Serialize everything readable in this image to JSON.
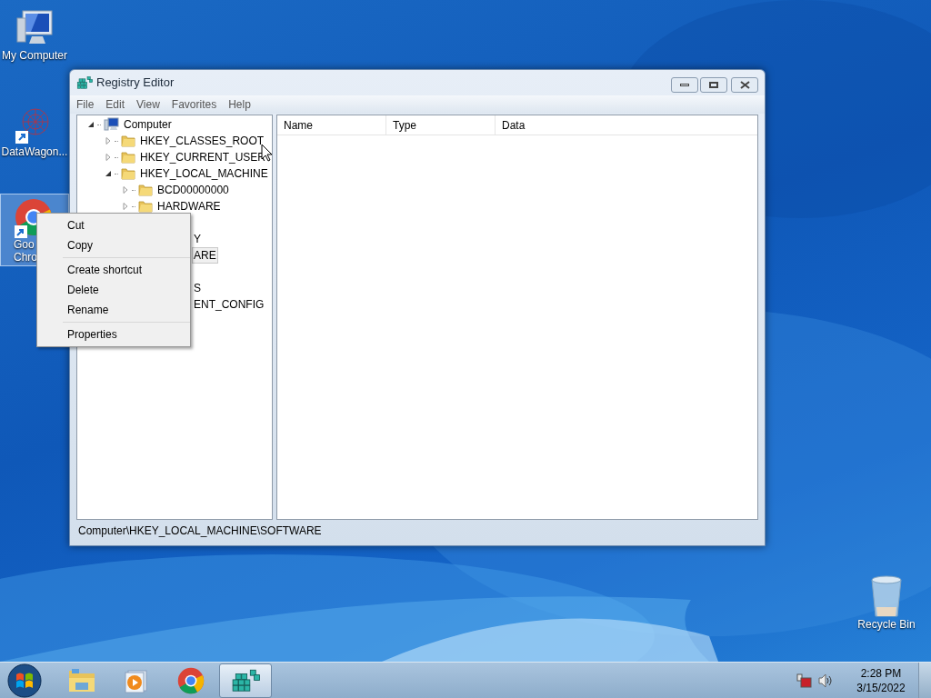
{
  "desktop_icons": [
    {
      "kind": "computer",
      "label_lines": [
        "My Computer"
      ],
      "selected": false
    },
    {
      "kind": "network",
      "label_lines": [
        "DataWagon..."
      ],
      "selected": false
    },
    {
      "kind": "chrome",
      "label_lines": [
        "Goo",
        "Chro"
      ],
      "selected": true
    },
    {
      "kind": "bin",
      "label_lines": [
        "Recycle Bin"
      ],
      "selected": false
    }
  ],
  "window": {
    "title": "Registry Editor",
    "menu": [
      "File",
      "Edit",
      "View",
      "Favorites",
      "Help"
    ],
    "tree": {
      "text": "Computer",
      "expanded": true,
      "children": [
        {
          "text": "HKEY_CLASSES_ROOT",
          "expanded": false
        },
        {
          "text": "HKEY_CURRENT_USER",
          "expanded": false
        },
        {
          "text": "HKEY_LOCAL_MACHINE",
          "expanded": true,
          "children": [
            {
              "text": "BCD00000000",
              "expanded": false
            },
            {
              "text": "HARDWARE",
              "expanded": false
            },
            {
              "kind": "hidden"
            },
            {
              "kind": "covered",
              "text": "Y",
              "selected": false
            },
            {
              "kind": "covered",
              "text": "ARE",
              "selected": true
            },
            {
              "kind": "hidden"
            }
          ]
        },
        {
          "kind": "covered",
          "text": "S",
          "selected": false
        },
        {
          "kind": "covered",
          "text": "ENT_CONFIG",
          "selected": false
        }
      ]
    },
    "columns": [
      "Name",
      "Type",
      "Data"
    ],
    "status_bar": "Computer\\HKEY_LOCAL_MACHINE\\SOFTWARE"
  },
  "context_menu": [
    [
      "Cut",
      "Copy"
    ],
    [
      "Create shortcut",
      "Delete",
      "Rename"
    ],
    [
      "Properties"
    ]
  ],
  "taskbar": {
    "apps": [
      {
        "kind": "explorer",
        "selected": false
      },
      {
        "kind": "media",
        "selected": false
      },
      {
        "kind": "chrome",
        "selected": false
      },
      {
        "kind": "regedit",
        "selected": true
      }
    ],
    "time": "2:28 PM",
    "date": "3/15/2022"
  }
}
